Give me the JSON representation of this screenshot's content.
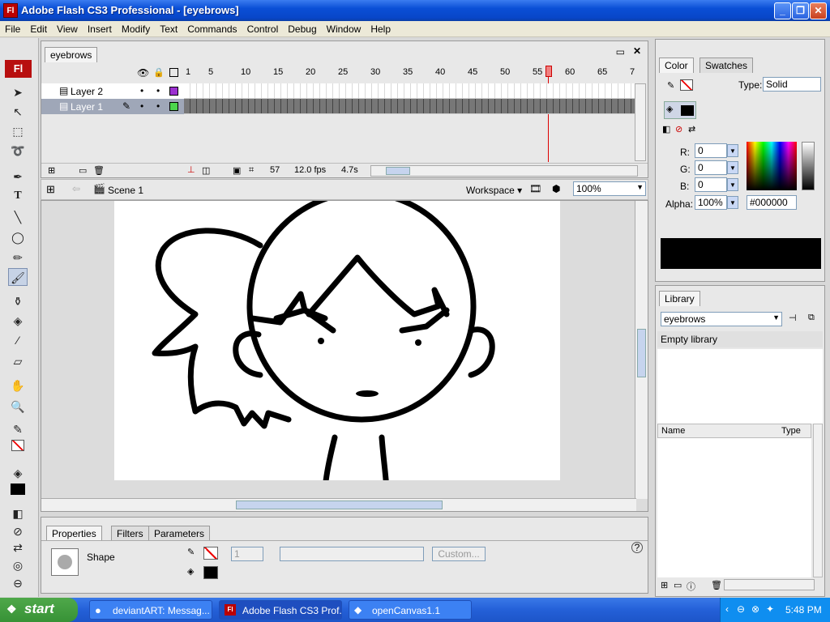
{
  "window": {
    "title": "Adobe Flash CS3 Professional - [eyebrows]",
    "app_icon": "Fl"
  },
  "menu": [
    "File",
    "Edit",
    "View",
    "Insert",
    "Modify",
    "Text",
    "Commands",
    "Control",
    "Debug",
    "Window",
    "Help"
  ],
  "tools_logo": "Fl",
  "timeline": {
    "doc_tab": "eyebrows",
    "ruler": [
      "1",
      "5",
      "10",
      "15",
      "20",
      "25",
      "30",
      "35",
      "40",
      "45",
      "50",
      "55",
      "60",
      "65",
      "7"
    ],
    "layers": [
      {
        "name": "Layer 2",
        "color": "#9b2fd0"
      },
      {
        "name": "Layer 1",
        "color": "#4cd64c"
      }
    ],
    "current_frame": "57",
    "fps": "12.0 fps",
    "time": "4.7s"
  },
  "editbar": {
    "scene": "Scene 1",
    "workspace": "Workspace ▾",
    "zoom": "100%"
  },
  "properties": {
    "tabs": [
      "Properties",
      "Filters",
      "Parameters"
    ],
    "shape_label": "Shape",
    "stroke_height": "1",
    "custom_btn": "Custom..."
  },
  "color_panel": {
    "tabs": [
      "Color",
      "Swatches"
    ],
    "type_label": "Type:",
    "type_value": "Solid",
    "r_label": "R:",
    "r": "0",
    "g_label": "G:",
    "g": "0",
    "b_label": "B:",
    "b": "0",
    "alpha_label": "Alpha:",
    "alpha": "100%",
    "hex": "#000000",
    "fill_color": "#000000"
  },
  "library": {
    "tab": "Library",
    "doc": "eyebrows",
    "status": "Empty library",
    "col_name": "Name",
    "col_type": "Type"
  },
  "taskbar": {
    "start": "start",
    "tasks": [
      "deviantART: Messag...",
      "Adobe Flash CS3 Prof...",
      "openCanvas1.1"
    ],
    "clock": "5:48 PM"
  }
}
